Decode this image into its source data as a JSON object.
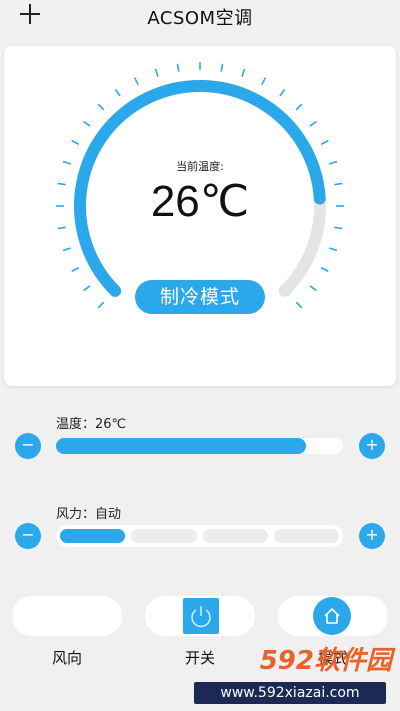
{
  "header": {
    "title": "ACSOM空调"
  },
  "dial": {
    "current_label": "当前温度:",
    "current_temp": "26℃",
    "mode": "制冷模式",
    "fill_fraction": 0.82
  },
  "temperature_row": {
    "label": "温度：26℃",
    "level_percent": 87
  },
  "fan_row": {
    "label": "风力：自动",
    "segments_total": 4,
    "segments_active": 1
  },
  "bottom": {
    "wind_direction_label": "风向",
    "power_label": "开关",
    "mode_label": "模式"
  },
  "watermark": {
    "brand": "592软件园",
    "url": "www.592xiazai.com"
  },
  "colors": {
    "accent": "#2aa8ea",
    "track": "#e4e4e4",
    "background": "#f0f0f0"
  },
  "icons": [
    "add-icon",
    "minus-icon",
    "plus-icon",
    "power-icon",
    "home-icon"
  ]
}
